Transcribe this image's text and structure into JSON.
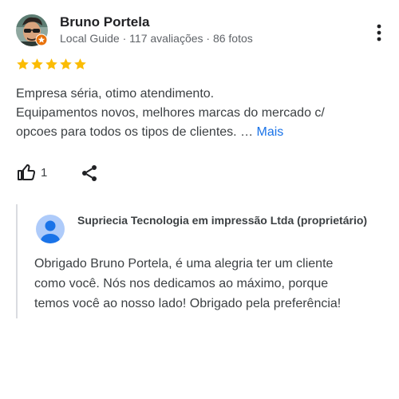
{
  "review": {
    "author_name": "Bruno Portela",
    "author_meta": "Local Guide · 117 avaliações · 86 fotos",
    "rating": 5,
    "rating_max": 5,
    "star_color": "#fbbc04",
    "text_lines": [
      "Empresa séria, otimo atendimento.",
      "Equipamentos novos, melhores marcas do mercado c/",
      "opcoes para todos os tipos de clientes. … "
    ],
    "more_label": "Mais",
    "like_count": "1"
  },
  "owner_reply": {
    "owner_name": "Supriecia Tecnologia em impressão Ltda (proprietário)",
    "text_lines": [
      "Obrigado Bruno Portela, é uma alegria ter um cliente",
      "como você. Nós nos dedicamos ao máximo, porque",
      "temos você ao nosso lado! Obrigado pela preferência!"
    ]
  },
  "icons": {
    "author_avatar": "avatar",
    "local_guide_badge": "local-guide-badge-icon",
    "more_menu": "more-vert-icon",
    "like": "thumb-up-icon",
    "share": "share-icon",
    "owner_avatar": "default-avatar-icon"
  },
  "colors": {
    "link": "#1a73e8",
    "secondary_text": "#5f6368",
    "badge": "#e8710a"
  }
}
